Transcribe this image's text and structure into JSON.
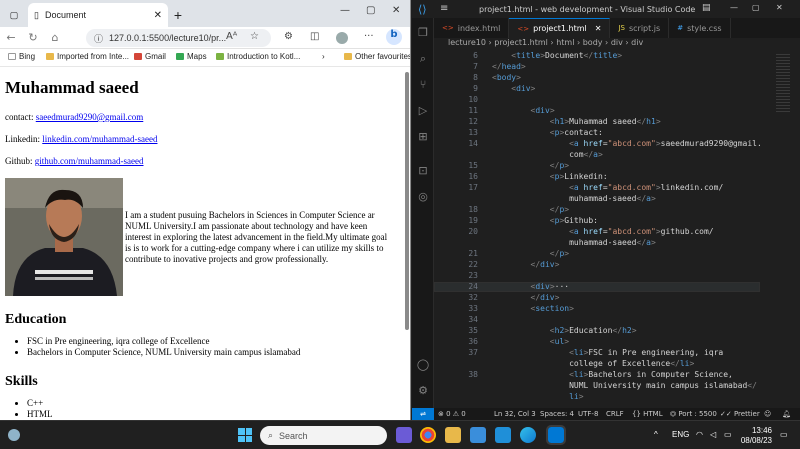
{
  "browser": {
    "tab_title": "Document",
    "url": "127.0.0.1:5500/lecture10/pr...",
    "read_aloud": "Aᴬ",
    "bookmarks": [
      "Bing",
      "Imported from Inte...",
      "Gmail",
      "Maps",
      "Introduction to Kotl...",
      "Other favourites"
    ],
    "page": {
      "name": "Muhammad saeed",
      "contact_label": "contact:",
      "contact_email": "saeedmurad9290@gmail.com",
      "linkedin_label": "Linkedin:",
      "linkedin_link": "linkedin.com/muhammad-saeed",
      "github_label": "Github:",
      "github_link": "github.com/muhammad-saeed",
      "bio": "I am a student pusuing Bachelors in Sciences in Computer Science ar NUML University.I am passionate about technology and have keen interest in exploring the latest advancement in the field.My ultimate goal is is to work for a cutting-edge company where i can utilize my skills to contribute to inovative projects and grow professionally.",
      "education_heading": "Education",
      "education": [
        "FSC in Pre engineering, iqra college of Excellence",
        "Bachelors in Computer Science, NUML University main campus islamabad"
      ],
      "skills_heading": "Skills",
      "skills": [
        "C++",
        "HTML"
      ]
    }
  },
  "vscode": {
    "title": "project1.html - web development - Visual Studio Code",
    "tabs": [
      "index.html",
      "project1.html",
      "script.js",
      "style.css"
    ],
    "active_tab": "project1.html",
    "breadcrumbs": [
      "lecture10",
      "project1.html",
      "html",
      "body",
      "div",
      "div"
    ],
    "lines": [
      {
        "n": "6",
        "html": "    <span class='br'>&lt;</span><span class='tag'>title</span><span class='br'>&gt;</span><span class='tx'>Document</span><span class='br'>&lt;/</span><span class='tag'>title</span><span class='br'>&gt;</span>"
      },
      {
        "n": "7",
        "html": "<span class='br'>&lt;/</span><span class='tag'>head</span><span class='br'>&gt;</span>"
      },
      {
        "n": "8",
        "html": "<span class='br'>&lt;</span><span class='tag'>body</span><span class='br'>&gt;</span>"
      },
      {
        "n": "9",
        "html": "    <span class='br'>&lt;</span><span class='tag'>div</span><span class='br'>&gt;</span>"
      },
      {
        "n": "10",
        "html": ""
      },
      {
        "n": "11",
        "html": "        <span class='br'>&lt;</span><span class='tag'>div</span><span class='br'>&gt;</span>"
      },
      {
        "n": "12",
        "html": "            <span class='br'>&lt;</span><span class='tag'>h1</span><span class='br'>&gt;</span><span class='tx'>Muhammad saeed</span><span class='br'>&lt;/</span><span class='tag'>h1</span><span class='br'>&gt;</span>"
      },
      {
        "n": "13",
        "html": "            <span class='br'>&lt;</span><span class='tag'>p</span><span class='br'>&gt;</span><span class='tx'>contact:</span>"
      },
      {
        "n": "14",
        "html": "                <span class='br'>&lt;</span><span class='tag'>a</span> <span class='attr'>href</span>=<span class='str'>\"abcd.com\"</span><span class='br'>&gt;</span><span class='tx'>saeedmurad9290@gmail.</span>"
      },
      {
        "n": "",
        "html": "                <span class='tx'>com</span><span class='br'>&lt;/</span><span class='tag'>a</span><span class='br'>&gt;</span>"
      },
      {
        "n": "15",
        "html": "            <span class='br'>&lt;/</span><span class='tag'>p</span><span class='br'>&gt;</span>"
      },
      {
        "n": "16",
        "html": "            <span class='br'>&lt;</span><span class='tag'>p</span><span class='br'>&gt;</span><span class='tx'>Linkedin:</span>"
      },
      {
        "n": "17",
        "html": "                <span class='br'>&lt;</span><span class='tag'>a</span> <span class='attr'>href</span>=<span class='str'>\"abcd.com\"</span><span class='br'>&gt;</span><span class='tx'>linkedin.com/</span>"
      },
      {
        "n": "",
        "html": "                <span class='tx'>muhammad-saeed</span><span class='br'>&lt;/</span><span class='tag'>a</span><span class='br'>&gt;</span>"
      },
      {
        "n": "18",
        "html": "            <span class='br'>&lt;/</span><span class='tag'>p</span><span class='br'>&gt;</span>"
      },
      {
        "n": "19",
        "html": "            <span class='br'>&lt;</span><span class='tag'>p</span><span class='br'>&gt;</span><span class='tx'>Github:</span>"
      },
      {
        "n": "20",
        "html": "                <span class='br'>&lt;</span><span class='tag'>a</span> <span class='attr'>href</span>=<span class='str'>\"abcd.com\"</span><span class='br'>&gt;</span><span class='tx'>github.com/</span>"
      },
      {
        "n": "",
        "html": "                <span class='tx'>muhammad-saeed</span><span class='br'>&lt;/</span><span class='tag'>a</span><span class='br'>&gt;</span>"
      },
      {
        "n": "21",
        "html": "            <span class='br'>&lt;/</span><span class='tag'>p</span><span class='br'>&gt;</span>"
      },
      {
        "n": "22",
        "html": "        <span class='br'>&lt;/</span><span class='tag'>div</span><span class='br'>&gt;</span>"
      },
      {
        "n": "23",
        "html": ""
      },
      {
        "n": "24",
        "html": "        <span class='br'>&lt;</span><span class='tag'>div</span><span class='br'>&gt;</span><span class='tx'>···</span>"
      },
      {
        "n": "32",
        "html": "        <span class='br'>&lt;/</span><span class='tag'>div</span><span class='br'>&gt;</span>"
      },
      {
        "n": "33",
        "html": "        <span class='br'>&lt;</span><span class='tag'>section</span><span class='br'>&gt;</span>"
      },
      {
        "n": "34",
        "html": ""
      },
      {
        "n": "35",
        "html": "            <span class='br'>&lt;</span><span class='tag'>h2</span><span class='br'>&gt;</span><span class='tx'>Education</span><span class='br'>&lt;/</span><span class='tag'>h2</span><span class='br'>&gt;</span>"
      },
      {
        "n": "36",
        "html": "            <span class='br'>&lt;</span><span class='tag'>ul</span><span class='br'>&gt;</span>"
      },
      {
        "n": "37",
        "html": "                <span class='br'>&lt;</span><span class='tag'>li</span><span class='br'>&gt;</span><span class='tx'>FSC in Pre engineering, iqra</span>"
      },
      {
        "n": "",
        "html": "                <span class='tx'>college of Excellence</span><span class='br'>&lt;/</span><span class='tag'>li</span><span class='br'>&gt;</span>"
      },
      {
        "n": "38",
        "html": "                <span class='br'>&lt;</span><span class='tag'>li</span><span class='br'>&gt;</span><span class='tx'>Bachelors in Computer Science,</span>"
      },
      {
        "n": "",
        "html": "                <span class='tx'>NUML University main campus islamabad</span><span class='br'>&lt;/</span>"
      },
      {
        "n": "",
        "html": "                <span class='tag'>li</span><span class='br'>&gt;</span>"
      }
    ],
    "status": {
      "errors": "⊗ 0 ⚠ 0",
      "cursor": "Ln 32, Col 3",
      "spaces": "Spaces: 4",
      "encoding": "UTF-8",
      "eol": "CRLF",
      "language": "{} HTML",
      "port": "⏣ Port : 5500",
      "prettier": "✓✓ Prettier"
    }
  },
  "taskbar": {
    "search_placeholder": "Search",
    "lang": "ENG",
    "time": "13:46",
    "date": "08/08/23"
  }
}
